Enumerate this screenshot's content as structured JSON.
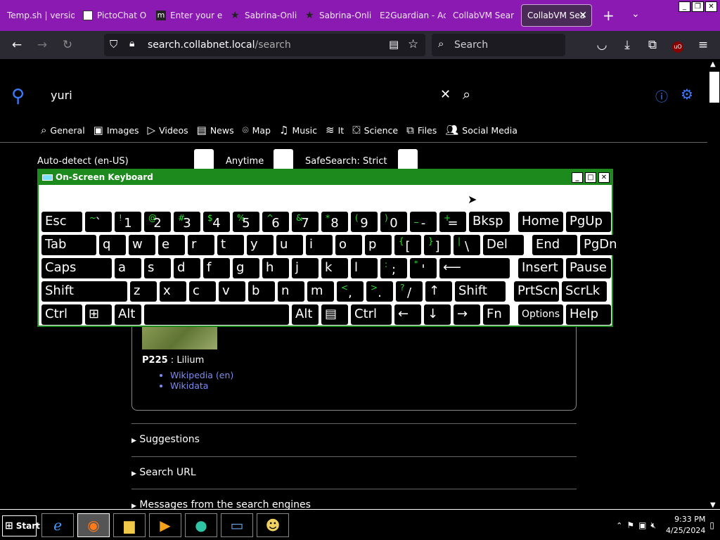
{
  "window_controls": [
    "_",
    "❐",
    "✕"
  ],
  "tabs": [
    {
      "label": "Temp.sh | version",
      "favicon": "temp-favicon"
    },
    {
      "label": "PictoChat O",
      "favicon": "pictochat-favicon"
    },
    {
      "label": "Enter your e",
      "favicon": "m-favicon"
    },
    {
      "label": "Sabrina-Onli",
      "favicon": "star-favicon"
    },
    {
      "label": "Sabrina-Onli",
      "favicon": "star-favicon"
    },
    {
      "label": "E2Guardian - Ac",
      "favicon": "none"
    },
    {
      "label": "CollabVM Sear",
      "favicon": "none"
    },
    {
      "label": "CollabVM Sea",
      "favicon": "none",
      "active": true
    }
  ],
  "navbar": {
    "url_host": "search.collabnet.local",
    "url_path": "/search",
    "search_placeholder": "Search"
  },
  "search": {
    "query": "yuri",
    "categories": [
      "General",
      "Images",
      "Videos",
      "News",
      "Map",
      "Music",
      "It",
      "Science",
      "Files",
      "Social Media"
    ],
    "filters": {
      "language": "Auto-detect (en-US)",
      "time": "Anytime",
      "safesearch": "SafeSearch: Strict"
    }
  },
  "infobox": {
    "prop_key": "P225",
    "prop_sep": " : ",
    "prop_value": "Lilium",
    "links": [
      "Wikipedia (en)",
      "Wikidata"
    ]
  },
  "sections": [
    "Suggestions",
    "Search URL",
    "Messages from the search engines"
  ],
  "osk": {
    "title": "On-Screen Keyboard",
    "rows": [
      [
        [
          "Esc",
          ""
        ],
        [
          "`",
          "~"
        ],
        [
          "1",
          "!"
        ],
        [
          "2",
          "@"
        ],
        [
          "3",
          "#"
        ],
        [
          "4",
          "$"
        ],
        [
          "5",
          "%"
        ],
        [
          "6",
          "^"
        ],
        [
          "7",
          "&"
        ],
        [
          "8",
          "*"
        ],
        [
          "9",
          "("
        ],
        [
          "0",
          ")"
        ],
        [
          "-",
          "_"
        ],
        [
          "=",
          "+"
        ],
        [
          "Bksp",
          ""
        ],
        [
          "Home",
          ""
        ],
        [
          "PgUp",
          ""
        ]
      ],
      [
        [
          "Tab",
          ""
        ],
        [
          "q",
          ""
        ],
        [
          "w",
          ""
        ],
        [
          "e",
          ""
        ],
        [
          "r",
          ""
        ],
        [
          "t",
          ""
        ],
        [
          "y",
          ""
        ],
        [
          "u",
          ""
        ],
        [
          "i",
          ""
        ],
        [
          "o",
          ""
        ],
        [
          "p",
          ""
        ],
        [
          "[",
          "{"
        ],
        [
          "]",
          "}"
        ],
        [
          "\\",
          "|"
        ],
        [
          "Del",
          ""
        ],
        [
          "End",
          ""
        ],
        [
          "PgDn",
          ""
        ]
      ],
      [
        [
          "Caps",
          ""
        ],
        [
          "a",
          ""
        ],
        [
          "s",
          ""
        ],
        [
          "d",
          ""
        ],
        [
          "f",
          ""
        ],
        [
          "g",
          ""
        ],
        [
          "h",
          ""
        ],
        [
          "j",
          ""
        ],
        [
          "k",
          ""
        ],
        [
          "l",
          ""
        ],
        [
          ";",
          ":"
        ],
        [
          "'",
          "\""
        ],
        [
          "⟵",
          ""
        ],
        [
          "Insert",
          ""
        ],
        [
          "Pause",
          ""
        ]
      ],
      [
        [
          "Shift",
          ""
        ],
        [
          "z",
          ""
        ],
        [
          "x",
          ""
        ],
        [
          "c",
          ""
        ],
        [
          "v",
          ""
        ],
        [
          "b",
          ""
        ],
        [
          "n",
          ""
        ],
        [
          "m",
          ""
        ],
        [
          ",",
          "<"
        ],
        [
          ".",
          ">"
        ],
        [
          "/",
          "?"
        ],
        [
          "↑",
          ""
        ],
        [
          "Shift",
          ""
        ],
        [
          "PrtScn",
          ""
        ],
        [
          "ScrLk",
          ""
        ]
      ],
      [
        [
          "Ctrl",
          ""
        ],
        [
          "⊞",
          ""
        ],
        [
          "Alt",
          ""
        ],
        [
          "",
          ""
        ],
        [
          "Alt",
          ""
        ],
        [
          "▤",
          ""
        ],
        [
          "Ctrl",
          ""
        ],
        [
          "←",
          ""
        ],
        [
          "↓",
          ""
        ],
        [
          "→",
          ""
        ],
        [
          "Fn",
          ""
        ],
        [
          "Options",
          ""
        ],
        [
          "Help",
          ""
        ]
      ]
    ]
  },
  "taskbar": {
    "start_label": "Start",
    "apps": [
      "ie-icon",
      "firefox-icon",
      "explorer-icon",
      "media-player-icon",
      "network-globe-icon",
      "computer-icon",
      "users-icon"
    ],
    "time": "9:33 PM",
    "date": "4/25/2024"
  }
}
